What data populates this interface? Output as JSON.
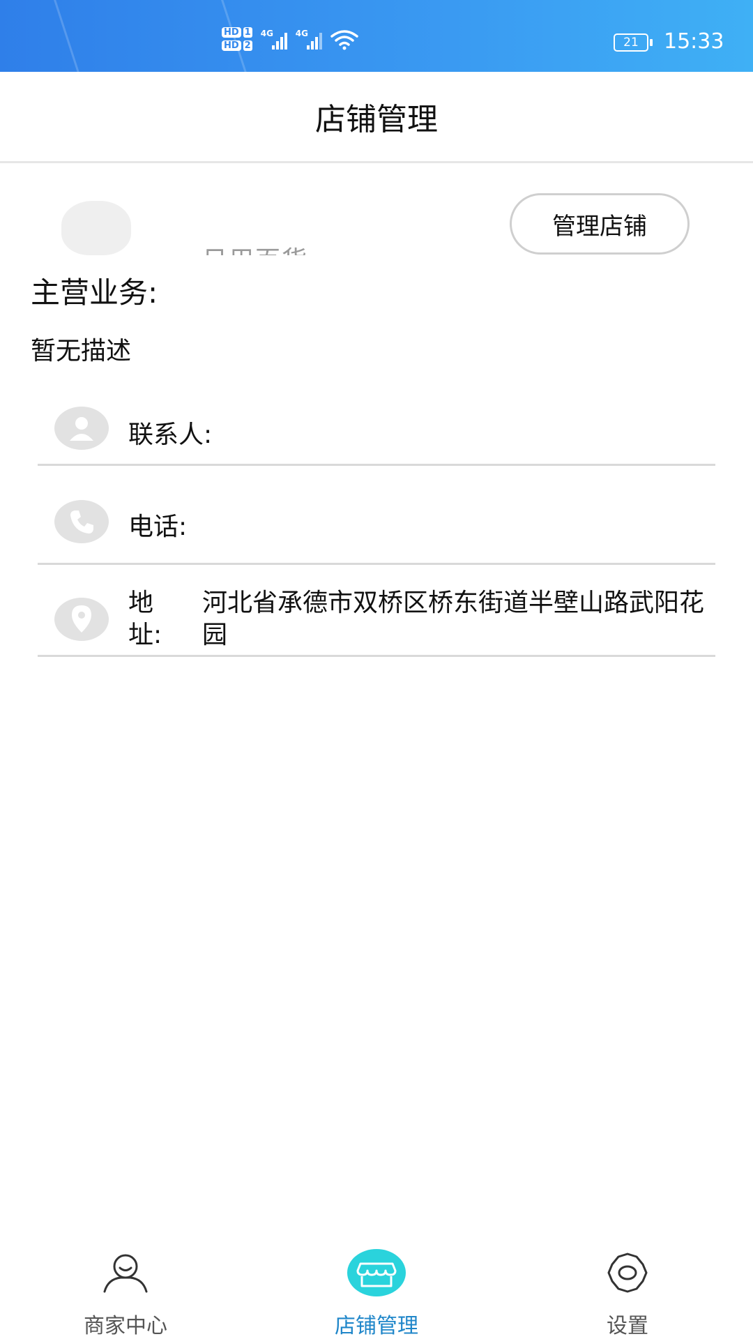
{
  "status_bar": {
    "hd1_label": "HD",
    "hd1_num": "1",
    "hd2_label": "HD",
    "hd2_num": "2",
    "sig1_label": "4G",
    "sig2_label": "4G",
    "battery": "21",
    "time": "15:33",
    "icons": [
      "signal-icon",
      "wifi-icon",
      "battery-icon"
    ]
  },
  "header": {
    "title": "店铺管理"
  },
  "shop": {
    "name": "日用百货",
    "manage_button": "管理店铺"
  },
  "business": {
    "label": "主营业务:",
    "description": "暂无描述"
  },
  "info": {
    "contact": {
      "icon": "person-icon",
      "label": "联系人:",
      "value": ""
    },
    "phone": {
      "icon": "phone-icon",
      "label": "电话:",
      "value": ""
    },
    "address": {
      "icon": "location-pin-icon",
      "label_line1": "地",
      "label_line2": "址:",
      "value": "河北省承德市双桥区桥东街道半壁山路武阳花园"
    }
  },
  "bottom_nav": {
    "items": [
      {
        "label": "商家中心",
        "icon": "merchant-user-icon",
        "active": false
      },
      {
        "label": "店铺管理",
        "icon": "store-icon",
        "active": true
      },
      {
        "label": "设置",
        "icon": "gear-icon",
        "active": false
      }
    ],
    "active_color": "#1f86c9",
    "active_icon_color": "#2ad3dc"
  }
}
